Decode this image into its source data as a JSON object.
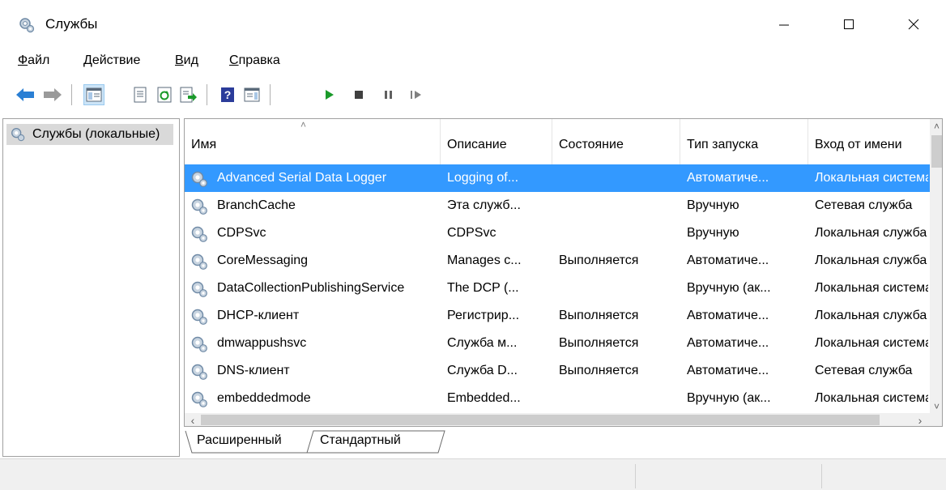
{
  "window": {
    "title": "Службы",
    "icon": "services-gear-icon",
    "controls": {
      "minimize": "minimize-icon",
      "maximize": "maximize-icon",
      "close": "close-icon"
    }
  },
  "menu": [
    {
      "label": "Файл",
      "accel": "Ф",
      "rest": "айл"
    },
    {
      "label": "Действие",
      "accel": "Д",
      "rest": "ействие"
    },
    {
      "label": "Вид",
      "accel": "В",
      "rest": "ид"
    },
    {
      "label": "Справка",
      "accel": "С",
      "rest": "правка"
    }
  ],
  "toolbar": {
    "icons": [
      "back-arrow-icon",
      "forward-arrow-icon",
      "console-tree-icon",
      "properties-icon",
      "refresh-icon",
      "export-list-icon",
      "help-icon",
      "action-pane-icon",
      "start-service-icon",
      "stop-service-icon",
      "pause-service-icon",
      "resume-service-icon"
    ],
    "colors": {
      "back_arrow": "#2a7fd4",
      "start": "#1a9a2a",
      "stop": "#404040"
    }
  },
  "tree": {
    "root_label": "Службы (локальные)"
  },
  "list": {
    "columns": [
      "Имя",
      "Описание",
      "Состояние",
      "Тип запуска",
      "Вход от имени"
    ],
    "rows": [
      {
        "name": "Advanced Serial Data Logger",
        "desc": "Logging of...",
        "status": "",
        "startup": "Автоматиче...",
        "logon": "Локальная система",
        "selected": true
      },
      {
        "name": "BranchCache",
        "desc": "Эта служб...",
        "status": "",
        "startup": "Вручную",
        "logon": "Сетевая служба",
        "selected": false
      },
      {
        "name": "CDPSvc",
        "desc": "CDPSvc",
        "status": "",
        "startup": "Вручную",
        "logon": "Локальная служба",
        "selected": false
      },
      {
        "name": "CoreMessaging",
        "desc": "Manages c...",
        "status": "Выполняется",
        "startup": "Автоматиче...",
        "logon": "Локальная служба",
        "selected": false
      },
      {
        "name": "DataCollectionPublishingService",
        "desc": "The DCP (...",
        "status": "",
        "startup": "Вручную (ак...",
        "logon": "Локальная система",
        "selected": false
      },
      {
        "name": "DHCP-клиент",
        "desc": "Регистрир...",
        "status": "Выполняется",
        "startup": "Автоматиче...",
        "logon": "Локальная служба",
        "selected": false
      },
      {
        "name": "dmwappushsvc",
        "desc": "Служба м...",
        "status": "Выполняется",
        "startup": "Автоматиче...",
        "logon": "Локальная система",
        "selected": false
      },
      {
        "name": "DNS-клиент",
        "desc": "Служба D...",
        "status": "Выполняется",
        "startup": "Автоматиче...",
        "logon": "Сетевая служба",
        "selected": false
      },
      {
        "name": "embeddedmode",
        "desc": "Embedded...",
        "status": "",
        "startup": "Вручную (ак...",
        "logon": "Локальная система",
        "selected": false
      }
    ],
    "selection_color": "#3399ff"
  },
  "tabs": [
    {
      "label": "Расширенный",
      "active": false
    },
    {
      "label": "Стандартный",
      "active": true
    }
  ]
}
